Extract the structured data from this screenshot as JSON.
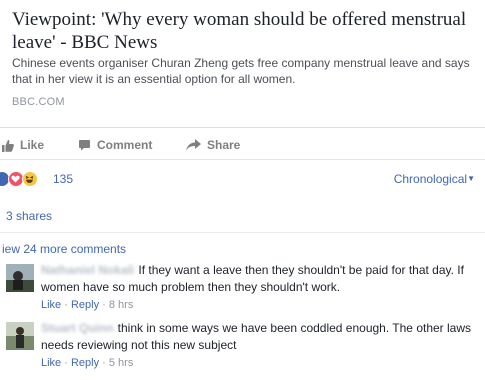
{
  "link_preview": {
    "title": "Viewpoint: 'Why every woman should be offered menstrual leave' - BBC News",
    "description": "Chinese events organiser Churan Zheng gets free company menstrual leave and says that in her view it is an essential option for all women.",
    "domain": "BBC.COM"
  },
  "actions": {
    "like": "Like",
    "comment": "Comment",
    "share": "Share"
  },
  "reactions": {
    "icons": [
      "like-reaction",
      "love-reaction",
      "haha-reaction"
    ],
    "count": "135",
    "sort_label": "Chronological"
  },
  "shares": "3 shares",
  "view_more": "iew 24 more comments",
  "comments": [
    {
      "author": "Nathaniel Nokali",
      "text": "If they want a leave then they shouldn't be paid for that day. If women have so much problem then they shouldn't work.",
      "like": "Like",
      "reply": "Reply",
      "time": "8 hrs"
    },
    {
      "author": "Stuart Quinn",
      "text": "think in some ways we have been coddled enough. The other laws needs reviewing not this new subject",
      "like": "Like",
      "reply": "Reply",
      "time": "5 hrs"
    }
  ],
  "colors": {
    "link": "#4267b2",
    "muted": "#90949c",
    "action": "#7f7f7f",
    "love": "#f25268",
    "haha": "#f7c544"
  }
}
